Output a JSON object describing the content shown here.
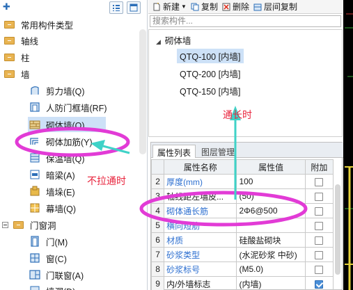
{
  "left_panel": {
    "tree": [
      {
        "label": "常用构件类型",
        "kind": "folder"
      },
      {
        "label": "轴线",
        "kind": "folder"
      },
      {
        "label": "柱",
        "kind": "folder"
      },
      {
        "label": "墙",
        "kind": "expanded"
      },
      {
        "label": "剪力墙(Q)",
        "kind": "item"
      },
      {
        "label": "人防门框墙(RF)",
        "kind": "item"
      },
      {
        "label": "砌体墙(Q)",
        "kind": "item",
        "selected": true
      },
      {
        "label": "砌体加筋(Y)",
        "kind": "item"
      },
      {
        "label": "保温墙(Q)",
        "kind": "item"
      },
      {
        "label": "暗梁(A)",
        "kind": "item"
      },
      {
        "label": "墙垛(E)",
        "kind": "item"
      },
      {
        "label": "幕墙(Q)",
        "kind": "item"
      },
      {
        "label": "门窗洞",
        "kind": "expanded"
      },
      {
        "label": "门(M)",
        "kind": "item"
      },
      {
        "label": "窗(C)",
        "kind": "item"
      },
      {
        "label": "门联窗(A)",
        "kind": "item"
      },
      {
        "label": "墙洞(D)",
        "kind": "item"
      }
    ]
  },
  "toolbar": {
    "new_label": "新建",
    "copy_label": "复制",
    "delete_label": "删除",
    "floor_copy_label": "层间复制"
  },
  "search": {
    "placeholder": "搜索构件..."
  },
  "component_tree": {
    "group": "砌体墙",
    "items": [
      "QTQ-100 [内墙]",
      "QTQ-200 [内墙]",
      "QTQ-150 [内墙]"
    ],
    "selected_index": 0
  },
  "properties": {
    "tabs": [
      "属性列表",
      "图层管理"
    ],
    "headers": [
      "属性名称",
      "属性值",
      "附加"
    ],
    "rows": [
      {
        "num": "2",
        "name": "厚度(mm)",
        "value": "100",
        "blue": true,
        "checked": false
      },
      {
        "num": "3",
        "name": "轴线距左墙皮...",
        "value": "(50)",
        "blue": false,
        "checked": false
      },
      {
        "num": "4",
        "name": "砌体通长筋",
        "value": "2Φ6@500",
        "blue": true,
        "checked": false
      },
      {
        "num": "5",
        "name": "横向短筋",
        "value": "",
        "blue": true,
        "checked": false
      },
      {
        "num": "6",
        "name": "材质",
        "value": "硅酸盐砌块",
        "blue": true,
        "checked": false
      },
      {
        "num": "7",
        "name": "砂浆类型",
        "value": "(水泥砂浆 中砂)",
        "blue": true,
        "checked": false
      },
      {
        "num": "8",
        "name": "砂浆标号",
        "value": "(M5.0)",
        "blue": true,
        "checked": false
      },
      {
        "num": "9",
        "name": "内/外墙标志",
        "value": "(内墙)",
        "blue": false,
        "checked": true
      }
    ]
  },
  "annotations": {
    "through_label": "通长时",
    "not_through_label": "不拉通时"
  },
  "colors": {
    "annotation": "#e8233c",
    "highlight_ellipse": "#e23bd6",
    "arrow": "#3fd2c7",
    "selection": "#cde1f7"
  }
}
